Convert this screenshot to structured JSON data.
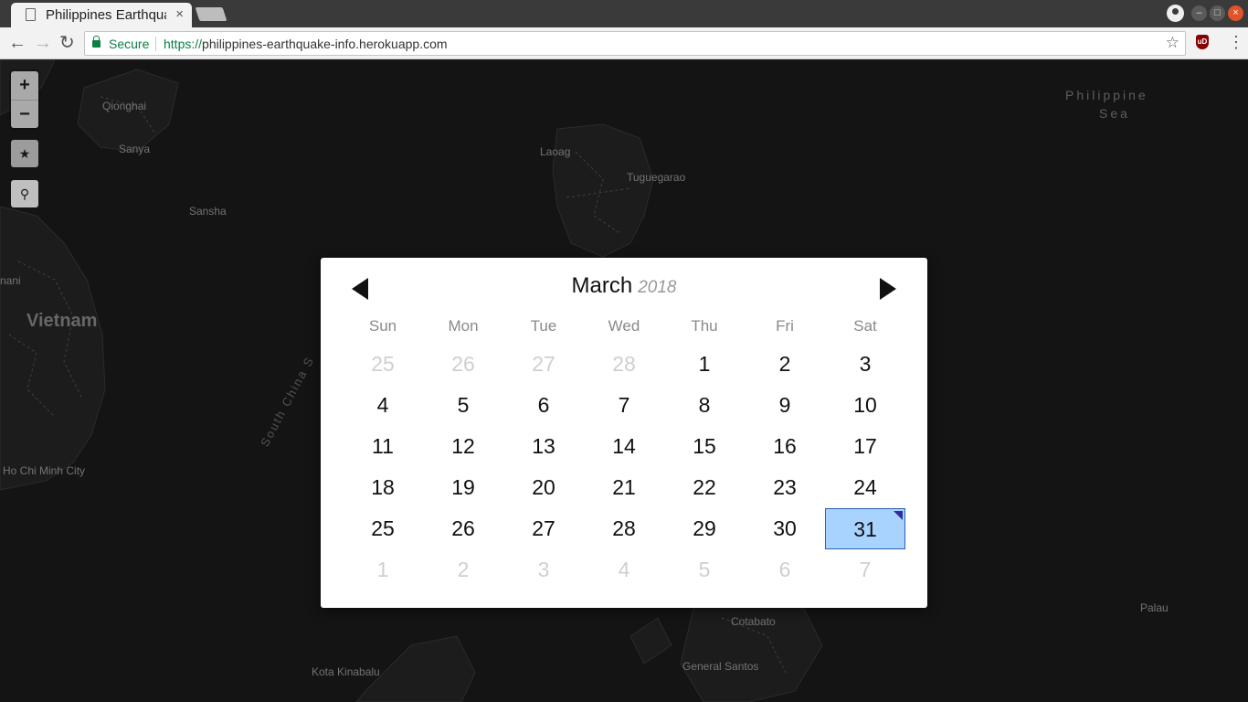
{
  "browser": {
    "tab_title": "Philippines Earthquake Info",
    "tab_close": "×",
    "secure_label": "Secure",
    "url_scheme": "https://",
    "url_host": "philippines-earthquake-info.herokuapp.com",
    "icons": {
      "back": "←",
      "forward": "→",
      "reload": "↻",
      "star": "☆",
      "menu": "⋮",
      "ublock": "uD",
      "minimize": "–",
      "maximize": "□",
      "close": "×"
    }
  },
  "map": {
    "zoom_in": "+",
    "zoom_out": "−",
    "star_icon": "★",
    "pin_icon": "⚲",
    "labels": {
      "qionghai": "Qionghai",
      "sanya": "Sanya",
      "sansha": "Sansha",
      "laoag": "Laoag",
      "tuguegarao": "Tuguegarao",
      "vietnam": "Vietnam",
      "hcmc": "Ho Chi Minh City",
      "south_china_sea": "South China S",
      "philippine_sea_1": "Philippine",
      "philippine_sea_2": "Sea",
      "palau": "Palau",
      "cotabato": "Cotabato",
      "general_santos": "General Santos",
      "kota_kinabalu": "Kota Kinabalu",
      "nani": "nani"
    }
  },
  "datepicker": {
    "month": "March",
    "year": "2018",
    "weekdays": [
      "Sun",
      "Mon",
      "Tue",
      "Wed",
      "Thu",
      "Fri",
      "Sat"
    ],
    "weeks": [
      [
        "25",
        "26",
        "27",
        "28",
        "1",
        "2",
        "3"
      ],
      [
        "4",
        "5",
        "6",
        "7",
        "8",
        "9",
        "10"
      ],
      [
        "11",
        "12",
        "13",
        "14",
        "15",
        "16",
        "17"
      ],
      [
        "18",
        "19",
        "20",
        "21",
        "22",
        "23",
        "24"
      ],
      [
        "25",
        "26",
        "27",
        "28",
        "29",
        "30",
        "31"
      ],
      [
        "1",
        "2",
        "3",
        "4",
        "5",
        "6",
        "7"
      ]
    ],
    "selected_day": "31",
    "colors": {
      "selected_bg": "#a8d3ff",
      "selected_border": "#2b5eb8",
      "muted_text": "#cfcfcf"
    }
  }
}
